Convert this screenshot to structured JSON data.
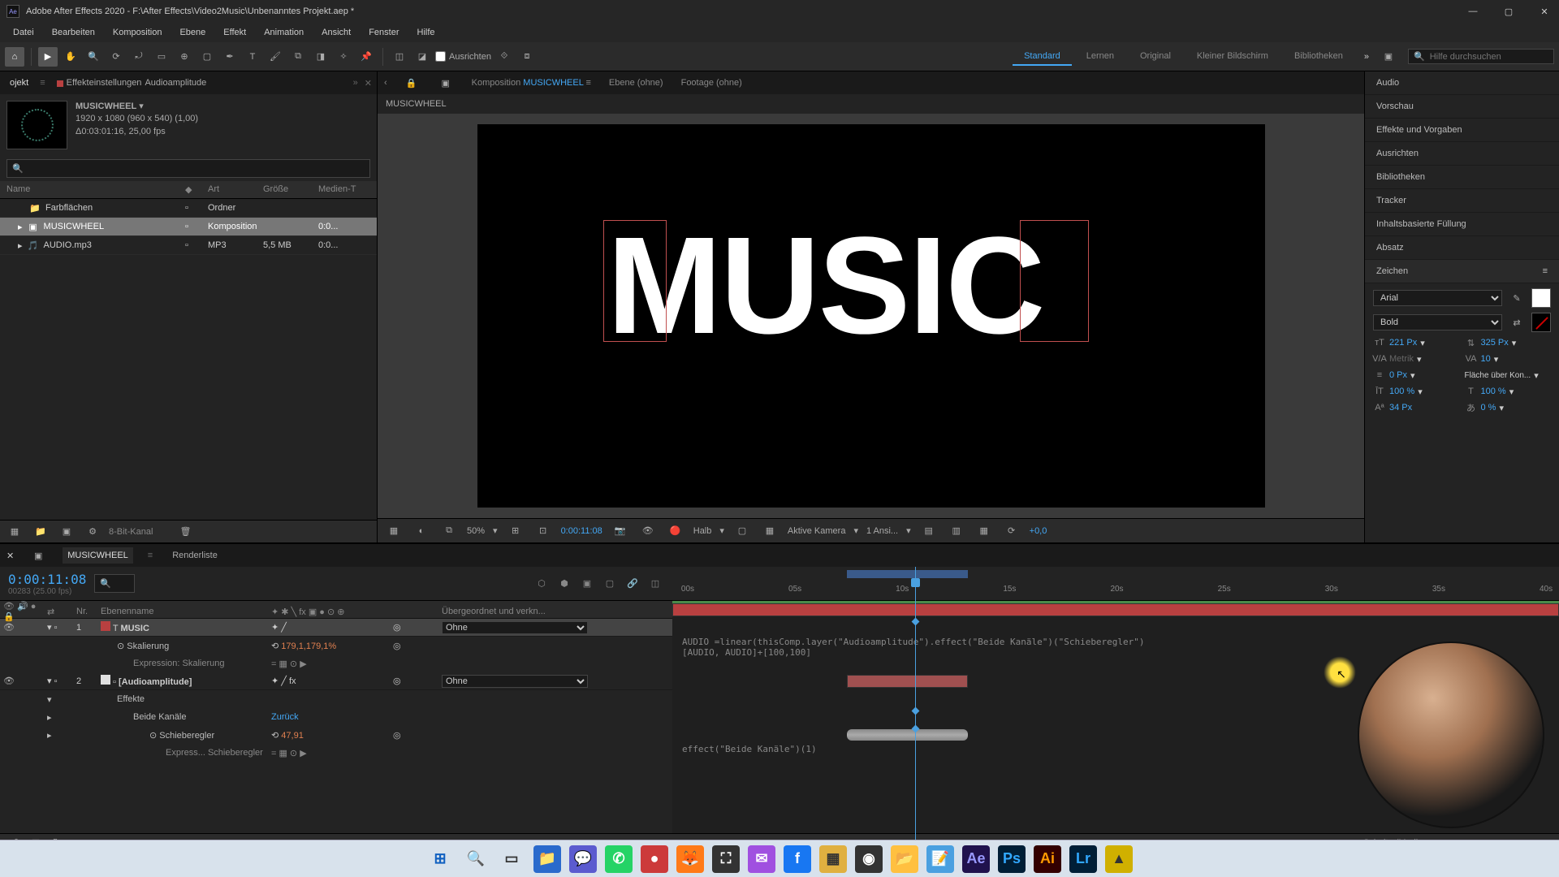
{
  "titlebar": {
    "app": "Adobe After Effects 2020",
    "file": "F:\\After Effects\\Video2Music\\Unbenanntes Projekt.aep *"
  },
  "menu": [
    "Datei",
    "Bearbeiten",
    "Komposition",
    "Ebene",
    "Effekt",
    "Animation",
    "Ansicht",
    "Fenster",
    "Hilfe"
  ],
  "toolbar": {
    "align_label": "Ausrichten",
    "workspaces": [
      "Standard",
      "Lernen",
      "Original",
      "Kleiner Bildschirm",
      "Bibliotheken"
    ],
    "active_workspace": "Standard",
    "search_placeholder": "Hilfe durchsuchen"
  },
  "left": {
    "tabs": {
      "proj": "ojekt",
      "effect": "Effekteinstellungen",
      "effect_target": "Audioamplitude"
    },
    "comp_name": "MUSICWHEEL",
    "meta_line1": "1920 x 1080 (960 x 540) (1,00)",
    "meta_line2": "Δ0:03:01:16, 25,00 fps",
    "columns": {
      "name": "Name",
      "art": "Art",
      "size": "Größe",
      "media": "Medien-T"
    },
    "rows": [
      {
        "indent": 1,
        "icon": "folder",
        "name": "Farbflächen",
        "art": "Ordner",
        "size": "",
        "media": ""
      },
      {
        "indent": 0,
        "icon": "comp",
        "name": "MUSICWHEEL",
        "art": "Komposition",
        "size": "",
        "media": "0:0...",
        "selected": true
      },
      {
        "indent": 0,
        "icon": "audio",
        "name": "AUDIO.mp3",
        "art": "MP3",
        "size": "5,5 MB",
        "media": "0:0..."
      }
    ],
    "footer_mode": "8-Bit-Kanal"
  },
  "comp_tabs": {
    "comp_label": "Komposition",
    "comp_name": "MUSICWHEEL",
    "layer_label": "Ebene  (ohne)",
    "footage_label": "Footage  (ohne)"
  },
  "crumb": "MUSICWHEEL",
  "canvas_text": "MUSIC",
  "viewer": {
    "zoom": "50%",
    "time": "0:00:11:08",
    "res": "Halb",
    "camera": "Aktive Kamera",
    "views": "1 Ansi...",
    "exposure": "+0,0"
  },
  "right_panels": [
    "Audio",
    "Vorschau",
    "Effekte und Vorgaben",
    "Ausrichten",
    "Bibliotheken",
    "Tracker",
    "Inhaltsbasierte Füllung",
    "Absatz",
    "Zeichen"
  ],
  "char": {
    "font": "Arial",
    "style": "Bold",
    "size": "221 Px",
    "leading": "325 Px",
    "kerning": "Metrik",
    "tracking": "10",
    "stroke": "0 Px",
    "fill_mode": "Fläche über Kon...",
    "vscale": "100 %",
    "hscale": "100 %",
    "baseline": "34 Px",
    "tsume": "0 %"
  },
  "timeline": {
    "tabs": {
      "comp": "MUSICWHEEL",
      "render": "Renderliste"
    },
    "timecode": "0:00:11:08",
    "timecode_sub": "00283 (25.00 fps)",
    "headers": {
      "nr": "Nr.",
      "name": "Ebenenname",
      "parent": "Übergeordnet und verkn..."
    },
    "footer": "Schalter/Modi",
    "ruler": [
      "00s",
      "05s",
      "10s",
      "15s",
      "20s",
      "25s",
      "30s",
      "35s",
      "40s"
    ],
    "workbar": {
      "start_pct": 19.7,
      "end_pct": 33.3
    },
    "playhead_pct": 27.4,
    "layers": [
      {
        "idx": "1",
        "color": "#b84040",
        "name": "MUSIC",
        "type": "text",
        "parent": "Ohne",
        "selected": true,
        "props": [
          {
            "name": "Skalierung",
            "value": "179,1,179,1%",
            "red": true,
            "hasExpr": true,
            "expr_label": "Expression: Skalierung",
            "expr_code": "AUDIO =linear(thisComp.layer(\"Audioamplitude\").effect(\"Beide Kanäle\")(\"Schieberegler\")\n[AUDIO, AUDIO]+[100,100]"
          }
        ]
      },
      {
        "idx": "2",
        "color": "#e0e0e0",
        "name": "[Audioamplitude]",
        "type": "solid",
        "parent": "Ohne",
        "fx": true,
        "props": [
          {
            "name": "Effekte",
            "group": true
          },
          {
            "name": "Beide Kanäle",
            "link": "Zurück",
            "sub": true
          },
          {
            "name": "Schieberegler",
            "value": "47,91",
            "red": true,
            "hasExpr": true,
            "sub2": true,
            "expr_label": "Express... Schieberegler",
            "expr_code": "effect(\"Beide Kanäle\")(1)"
          }
        ]
      }
    ]
  },
  "taskbar_icons": [
    {
      "name": "windows",
      "bg": "#d8e2ec",
      "txt": "⊞",
      "col": "#1060c0"
    },
    {
      "name": "search",
      "bg": "#d8e2ec",
      "txt": "🔍",
      "col": "#333"
    },
    {
      "name": "taskview",
      "bg": "#d8e2ec",
      "txt": "▭",
      "col": "#333"
    },
    {
      "name": "explorer",
      "bg": "#2a6acc",
      "txt": "📁",
      "col": "#fff"
    },
    {
      "name": "teams",
      "bg": "#5b5bcf",
      "txt": "💬",
      "col": "#fff"
    },
    {
      "name": "whatsapp",
      "bg": "#25d366",
      "txt": "✆",
      "col": "#fff"
    },
    {
      "name": "app1",
      "bg": "#cc3a3a",
      "txt": "●",
      "col": "#fff"
    },
    {
      "name": "firefox",
      "bg": "#ff7a18",
      "txt": "🦊",
      "col": "#fff"
    },
    {
      "name": "app2",
      "bg": "#333",
      "txt": "⛶",
      "col": "#fff"
    },
    {
      "name": "messenger",
      "bg": "#a050e0",
      "txt": "✉",
      "col": "#fff"
    },
    {
      "name": "facebook",
      "bg": "#1877f2",
      "txt": "f",
      "col": "#fff"
    },
    {
      "name": "app3",
      "bg": "#e0b040",
      "txt": "▦",
      "col": "#333"
    },
    {
      "name": "obs",
      "bg": "#333",
      "txt": "◉",
      "col": "#fff"
    },
    {
      "name": "files",
      "bg": "#ffc040",
      "txt": "📂",
      "col": "#333"
    },
    {
      "name": "notepad",
      "bg": "#4aa0e0",
      "txt": "📝",
      "col": "#fff"
    },
    {
      "name": "ae",
      "bg": "#20124d",
      "txt": "Ae",
      "col": "#9999ff"
    },
    {
      "name": "ps",
      "bg": "#001e36",
      "txt": "Ps",
      "col": "#31a8ff"
    },
    {
      "name": "ai",
      "bg": "#330000",
      "txt": "Ai",
      "col": "#ff9a00"
    },
    {
      "name": "lr",
      "bg": "#001e36",
      "txt": "Lr",
      "col": "#31a8ff"
    },
    {
      "name": "app4",
      "bg": "#d0b000",
      "txt": "▲",
      "col": "#333"
    }
  ]
}
